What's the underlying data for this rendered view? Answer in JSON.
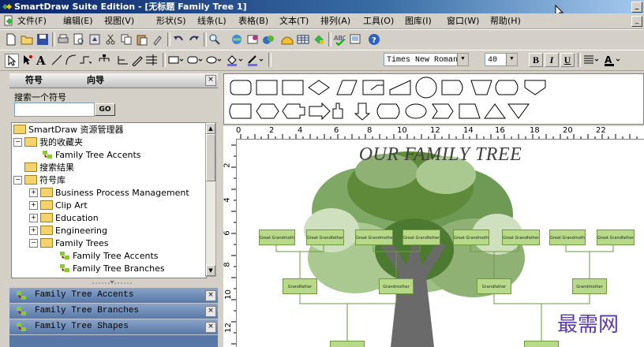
{
  "window": {
    "title": "SmartDraw Suite Edition - [无标题 Family Tree 1]",
    "minimize": "_"
  },
  "menubar": {
    "items": [
      "文件(F)",
      "编辑(E)",
      "视图(V)",
      "形状(S)",
      "线条(L)",
      "表格(B)",
      "文本(T)",
      "排列(A)",
      "工具(O)",
      "图库(I)",
      "窗口(W)",
      "帮助(H)"
    ],
    "doc_minimize": "_"
  },
  "format_toolbar": {
    "font_name": "Times New Roman",
    "font_size": "40",
    "bold": "B",
    "italic": "I",
    "underline": "U"
  },
  "left_panel": {
    "tabs": [
      "符号",
      "向导"
    ],
    "close": "×",
    "search_label": "搜索一个符号",
    "search_value": "",
    "go_button": "GO",
    "tree": [
      {
        "label": "SmartDraw 资源管理器",
        "level": 0
      },
      {
        "label": "我的收藏夹",
        "level": 0
      },
      {
        "label": "Family Tree Accents",
        "level": 2
      },
      {
        "label": "搜索结果",
        "level": 1
      },
      {
        "label": "符号库",
        "level": 0
      },
      {
        "label": "Business Process Management",
        "level": 1
      },
      {
        "label": "Clip Art",
        "level": 1
      },
      {
        "label": "Education",
        "level": 1
      },
      {
        "label": "Engineering",
        "level": 1
      },
      {
        "label": "Family Trees",
        "level": 1
      },
      {
        "label": "Family Tree Accents",
        "level": 2
      },
      {
        "label": "Family Tree Branches",
        "level": 2
      }
    ],
    "libraries": [
      "Family Tree Accents",
      "Family Tree Branches",
      "Family Tree Shapes"
    ]
  },
  "ruler": {
    "top": [
      "0",
      "2",
      "4",
      "6",
      "8",
      "10",
      "12",
      "14",
      "16",
      "18",
      "20",
      "22"
    ],
    "left": [
      "2",
      "4",
      "6",
      "8",
      "10",
      "12"
    ]
  },
  "canvas": {
    "title": "OUR FAMILY TREE",
    "great_grandparents": [
      "Great Grandmother",
      "Great Grandfather",
      "Great Grandmother",
      "Great Grandfather",
      "Great Grandmother",
      "Great Grandfather",
      "Great Grandmother",
      "Great Grandfather"
    ],
    "grandparents": [
      "Grandfather",
      "Grandmother",
      "Grandfather",
      "Grandmother"
    ],
    "watermark": "最需网"
  },
  "colors": {
    "tree_green": "#5e8a3a",
    "box_fill": "#b8d98a",
    "watermark": "#5a3aa8"
  }
}
